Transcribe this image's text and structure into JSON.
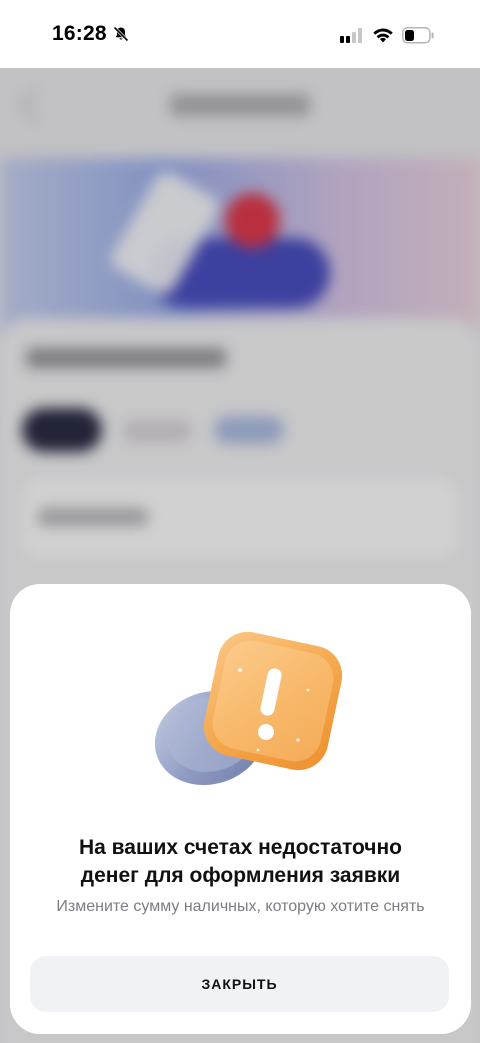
{
  "status_bar": {
    "time": "16:28",
    "icons": [
      "bell-slash-icon",
      "signal-icon",
      "wifi-icon",
      "battery-icon"
    ]
  },
  "dialog": {
    "illustration": "warning-coin-icon",
    "title_line1": "На ваших счетах недостаточно",
    "title_line2": "денег для оформления заявки",
    "subtitle": "Измените сумму наличных, которую хотите снять",
    "close_label": "ЗАКРЫТЬ"
  },
  "colors": {
    "warning_orange": "#f4a64a",
    "coin_blue": "#9aa6c8",
    "button_bg": "#f1f2f6"
  }
}
